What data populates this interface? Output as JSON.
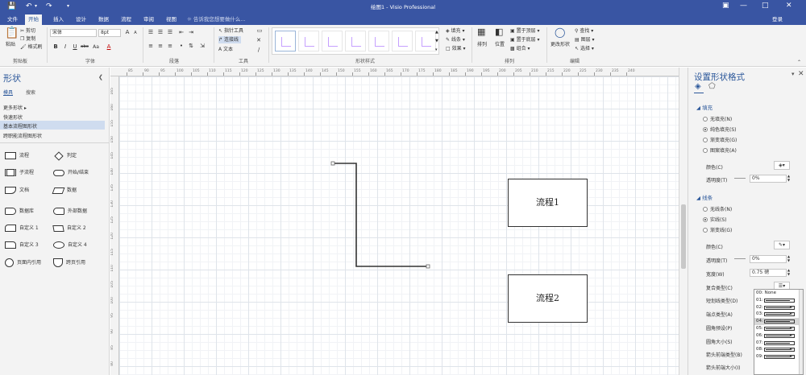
{
  "titlebar": {
    "title": "绘图1 - Visio Professional",
    "quick_access": {
      "save_icon": "save-icon",
      "undo_icon": "undo-icon",
      "redo_icon": "redo-icon",
      "customize_icon": "chevron-down-icon"
    }
  },
  "tabs": [
    {
      "label": "文件",
      "active": false
    },
    {
      "label": "开始",
      "active": true
    },
    {
      "label": "插入",
      "active": false
    },
    {
      "label": "设计",
      "active": false
    },
    {
      "label": "数据",
      "active": false
    },
    {
      "label": "流程",
      "active": false
    },
    {
      "label": "审阅",
      "active": false
    },
    {
      "label": "视图",
      "active": false
    }
  ],
  "tell_me": "告诉我您想要做什么...",
  "sign_in": "登录",
  "ribbon": {
    "clipboard": {
      "paste": "粘贴",
      "cut": "剪切",
      "copy": "复制",
      "format_painter": "格式刷",
      "label": "剪贴板"
    },
    "font": {
      "family": "宋体",
      "size": "8pt",
      "label": "字体",
      "bold": "B",
      "italic": "I",
      "underline": "U",
      "strike": "abc",
      "case": "Aa"
    },
    "paragraph": {
      "label": "段落"
    },
    "tools": {
      "pointer": "指针工具",
      "connector": "连接线",
      "text": "文本",
      "label": "工具"
    },
    "shape_styles": {
      "label": "形状样式"
    },
    "styles_options": {
      "fill": "填充",
      "line": "线条",
      "effects": "效果"
    },
    "arrange": {
      "arrange": "排列",
      "position": "位置",
      "bring_front": "置于顶层",
      "send_back": "置于底层",
      "group": "组合",
      "label": "排列"
    },
    "editing": {
      "change_shape": "更改形状",
      "find": "查找",
      "layers": "图层",
      "select": "选择",
      "label": "编辑"
    }
  },
  "shapes_panel": {
    "title": "形状",
    "tab_stencils": "模具",
    "tab_search": "搜索",
    "links": [
      "更多形状",
      "快速形状",
      "基本流程图形状",
      "跨职能流程图形状"
    ],
    "shapes": [
      [
        "流程",
        "判定"
      ],
      [
        "子流程",
        "开始/结束"
      ],
      [
        "文档",
        "数据"
      ],
      [
        "数据库",
        "外部数据"
      ],
      [
        "自定义 1",
        "自定义 2"
      ],
      [
        "自定义 3",
        "自定义 4"
      ],
      [
        "页面内引用",
        "跨页引用"
      ]
    ]
  },
  "canvas": {
    "shape1": "流程1",
    "shape2": "流程2"
  },
  "rulers": {
    "top": [
      "85",
      "90",
      "95",
      "100",
      "105",
      "110",
      "115",
      "120",
      "125",
      "130",
      "135",
      "140",
      "145",
      "150",
      "155",
      "160",
      "165",
      "170",
      "175",
      "180",
      "185",
      "190",
      "195",
      "200",
      "205",
      "210",
      "215",
      "220",
      "225",
      "230",
      "235",
      "240"
    ],
    "left": [
      "165",
      "160",
      "155",
      "150",
      "145",
      "140",
      "135",
      "130",
      "125",
      "120",
      "115",
      "110",
      "105",
      "100",
      "95",
      "90",
      "85",
      "80"
    ]
  },
  "format_panel": {
    "title": "设置形状格式",
    "fill_section": "填充",
    "fill_options": [
      "无填充(N)",
      "纯色填充(S)",
      "渐变填充(G)",
      "图案填充(A)"
    ],
    "fill_selected": 1,
    "fill_color_label": "颜色(C)",
    "fill_transparency_label": "透明度(T)",
    "fill_transparency_value": "0%",
    "line_section": "线条",
    "line_options": [
      "无线条(N)",
      "实线(S)",
      "渐变线(G)"
    ],
    "line_selected": 1,
    "line_color_label": "颜色(C)",
    "line_transparency_label": "透明度(T)",
    "line_transparency_value": "0%",
    "width_label": "宽度(W)",
    "width_value": "0.75 磅",
    "compound_label": "复合类型(C)",
    "dash_label": "短划线类型(D)",
    "cap_label": "端点类型(A)",
    "round_preset_label": "圆角预设(P)",
    "round_size_label": "圆角大小(S)",
    "begin_arrow_label": "箭头前端类型(B)",
    "begin_size_label": "箭头前端大小(I)"
  },
  "arrow_dropdown": [
    "00: None",
    "01:",
    "02:",
    "03:",
    "04:",
    "05:",
    "06:",
    "07:",
    "08:",
    "09:"
  ],
  "arrow_dropdown_highlight": 4
}
